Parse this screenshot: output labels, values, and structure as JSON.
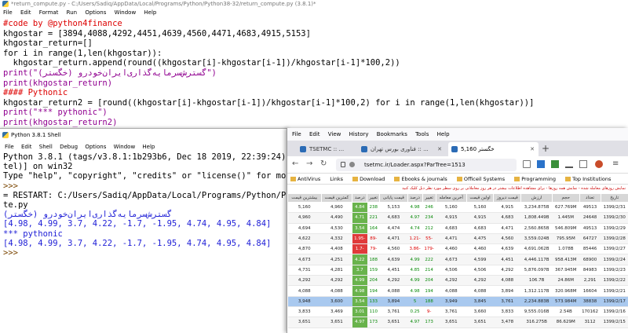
{
  "editor": {
    "title": "*return_compute.py - C:/Users/Sadiq/AppData/Local/Programs/Python/Python38-32/return_compute.py (3.8.1)*",
    "menu": [
      "File",
      "Edit",
      "Format",
      "Run",
      "Options",
      "Window",
      "Help"
    ],
    "lines": [
      "#code by @python4finance",
      "khgostar = [3894,4088,4292,4451,4639,4560,4471,4683,4915,5153]",
      "khgostar_return=[]",
      "for i in range(1,len(khgostar)):",
      "  khgostar_return.append(round((khgostar[i]-khgostar[i-1])/khgostar[i-1]*100,2))",
      "print(\"گسترش‌سرمایه‌گذاری‌ایران‌خودرو (خگستر)\")",
      "print(khgostar_return)",
      "#### Pythonic",
      "khgostar_return2 = [round((khgostar[i]-khgostar[i-1])/khgostar[i-1]*100,2) for i in range(1,len(khgostar))]",
      "print(\"*** pythonic\")",
      "print(khgostar_return2)"
    ]
  },
  "shell": {
    "title": "Python 3.8.1 Shell",
    "menu": [
      "File",
      "Edit",
      "Shell",
      "Debug",
      "Options",
      "Window",
      "Help"
    ],
    "lines": [
      {
        "text": "Python 3.8.1 (tags/v3.8.1:1b293b6, Dec 18 2019, 22:39:24) [MSC v.1916 32 bit (In",
        "c": "s-black"
      },
      {
        "text": "tel)] on win32",
        "c": "s-black"
      },
      {
        "text": "Type \"help\", \"copyright\", \"credits\" or \"license()\" for more information.",
        "c": "s-black"
      },
      {
        "text": ">>> ",
        "c": "s-prompt"
      },
      {
        "text": "= RESTART: C:/Users/Sadiq/AppData/Local/Programs/Python/Python38-32/return_compu",
        "c": "s-black"
      },
      {
        "text": "te.py",
        "c": "s-black"
      },
      {
        "text": "گسترش‌سرمایه‌گذاری‌ایران‌خودرو (خگستر)",
        "c": "s-blue"
      },
      {
        "text": "[4.98, 4.99, 3.7, 4.22, -1.7, -1.95, 4.74, 4.95, 4.84]",
        "c": "s-blue"
      },
      {
        "text": "*** pythonic",
        "c": "s-blue"
      },
      {
        "text": "[4.98, 4.99, 3.7, 4.22, -1.7, -1.95, 4.74, 4.95, 4.84]",
        "c": "s-blue"
      },
      {
        "text": ">>> ",
        "c": "s-prompt"
      }
    ]
  },
  "browser": {
    "menu": [
      "File",
      "Edit",
      "View",
      "History",
      "Bookmarks",
      "Tools",
      "Help"
    ],
    "tabs": [
      "TSETMC :: ...",
      "فناوری بورس تهران :: ...",
      "خگستر 5,160"
    ],
    "url": "tsetmc.ir/Loader.aspx?ParTree=1513",
    "bookmarks": [
      "AntiVirus",
      "Links",
      "Download",
      "Ebooks & journals",
      "Officeil Systems",
      "Programming",
      "Top Institutions"
    ],
    "notice": "نمایش روزهای معامله شده - نمایش همه روزها - برای مشاهده اطلاعات بیشتر در هر روز معاملاتی بر روی سطر مورد نظر دبل کلیک کنید",
    "columns": [
      "تاریخ",
      "تعداد",
      "حجم",
      "ارزش",
      "قیمت دیروز",
      "اولین قیمت",
      "آخرین معامله",
      "تغییر",
      "درصد",
      "قیمت پایانی",
      "تغییر",
      "درصد",
      "کمترین قیمت",
      "بیشترین قیمت"
    ],
    "rows": [
      [
        "1399/2/31",
        "49513",
        "627.769M",
        "3,234.875B",
        "4,915",
        "5,160",
        "5,160",
        "246",
        "4.98",
        "5,153",
        "238",
        "4.84",
        "4,960",
        "5,160"
      ],
      [
        "1399/2/30",
        "24648",
        "1.445M",
        "1,808.449B",
        "4,683",
        "4,915",
        "4,915",
        "234",
        "4.97",
        "4,683",
        "221",
        "4.71",
        "4,490",
        "4,960"
      ],
      [
        "1399/2/29",
        "49513",
        "546.809M",
        "2,560.865B",
        "4,471",
        "4,683",
        "4,683",
        "212",
        "4.74",
        "4,474",
        "164",
        "3.54",
        "4,530",
        "4,694"
      ],
      [
        "1399/2/28",
        "64727",
        "795.95M",
        "3,559.024B",
        "4,560",
        "4,475",
        "4,471",
        "-55",
        "-1.21",
        "4,471",
        "-89",
        "-1.95",
        "4,332",
        "4,622"
      ],
      [
        "1399/2/27",
        "85446",
        "1.078B",
        "4,691.062B",
        "4,639",
        "4,460",
        "4,460",
        "-179",
        "-3.86",
        "4,560",
        "-79",
        "-1.7",
        "4,408",
        "4,870"
      ],
      [
        "1399/2/24",
        "68900",
        "958.413M",
        "4,446.117B",
        "4,451",
        "4,599",
        "4,673",
        "222",
        "4.99",
        "4,639",
        "188",
        "4.22",
        "4,251",
        "4,673"
      ],
      [
        "1399/2/23",
        "84983",
        "367.945M",
        "5,876.097B",
        "4,292",
        "4,506",
        "4,506",
        "214",
        "4.85",
        "4,451",
        "159",
        "3.7",
        "4,281",
        "4,731"
      ],
      [
        "1399/2/22",
        "2,291",
        "24.86M",
        "106.7B",
        "4,088",
        "4,292",
        "4,292",
        "204",
        "4.99",
        "4,292",
        "204",
        "4.99",
        "4,292",
        "4,292"
      ],
      [
        "1399/2/21",
        "16604",
        "320.968M",
        "1,312.117B",
        "3,894",
        "4,088",
        "4,088",
        "194",
        "4.98",
        "4,088",
        "194",
        "4.98",
        "4,088",
        "4,088"
      ],
      [
        "1399/2/17",
        "38838",
        "573.984M",
        "2,234.883B",
        "3,761",
        "3,845",
        "3,949",
        "188",
        "5",
        "3,894",
        "133",
        "3.54",
        "3,600",
        "3,948"
      ],
      [
        "1399/2/16",
        "170162",
        "2.54B",
        "9,555.016B",
        "3,833",
        "3,660",
        "3,761",
        "-9",
        "0.25",
        "3,761",
        "110",
        "3.01",
        "3,469",
        "3,833"
      ],
      [
        "1399/2/15",
        "3112",
        "86.629M",
        "316.275B",
        "3,478",
        "3,651",
        "3,651",
        "173",
        "4.97",
        "3,651",
        "173",
        "4.97",
        "3,651",
        "3,651"
      ]
    ]
  }
}
